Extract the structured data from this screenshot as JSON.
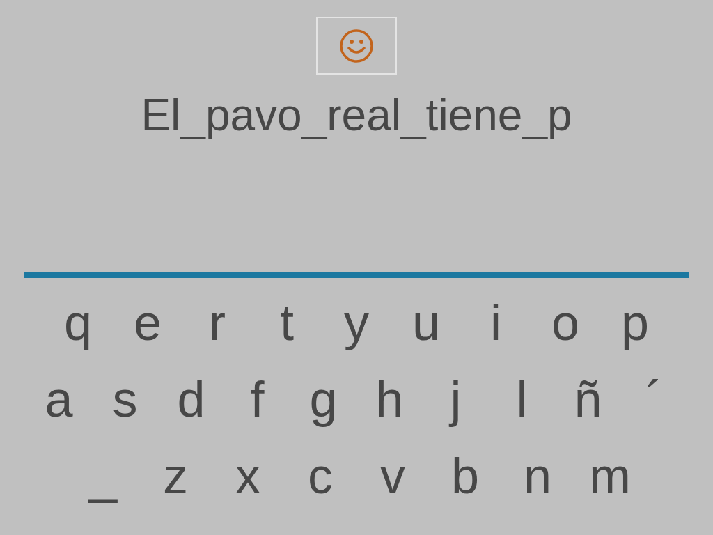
{
  "phrase": "El_pavo_real_tiene_p",
  "keyboard": {
    "rows": [
      [
        "q",
        "e",
        "r",
        "t",
        "y",
        "u",
        "i",
        "o",
        "p"
      ],
      [
        "a",
        "s",
        "d",
        "f",
        "g",
        "h",
        "j",
        "l",
        "ñ",
        "´"
      ],
      [
        "_",
        "z",
        "x",
        "c",
        "v",
        "b",
        "n",
        "m"
      ]
    ]
  }
}
